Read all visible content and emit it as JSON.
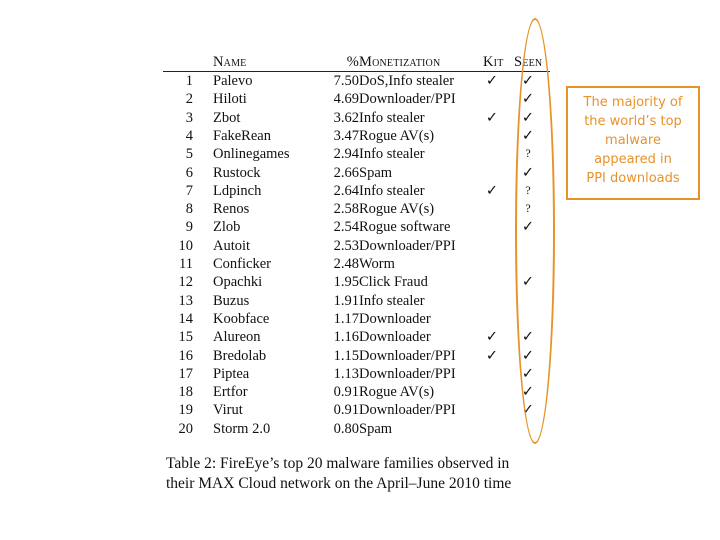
{
  "table": {
    "headers": {
      "rank": "",
      "name": "Name",
      "percent": "%",
      "monetization": "Monetization",
      "kit": "Kit",
      "seen": "Seen"
    },
    "rows": [
      {
        "rank": "1",
        "name": "Palevo",
        "percent": "7.50",
        "monetization": "DoS,Info stealer",
        "kit": "✓",
        "seen": "✓"
      },
      {
        "rank": "2",
        "name": "Hiloti",
        "percent": "4.69",
        "monetization": "Downloader/PPI",
        "kit": "",
        "seen": "✓"
      },
      {
        "rank": "3",
        "name": "Zbot",
        "percent": "3.62",
        "monetization": "Info stealer",
        "kit": "✓",
        "seen": "✓"
      },
      {
        "rank": "4",
        "name": "FakeRean",
        "percent": "3.47",
        "monetization": "Rogue AV(s)",
        "kit": "",
        "seen": "✓"
      },
      {
        "rank": "5",
        "name": "Onlinegames",
        "percent": "2.94",
        "monetization": "Info stealer",
        "kit": "",
        "seen": "?"
      },
      {
        "rank": "6",
        "name": "Rustock",
        "percent": "2.66",
        "monetization": "Spam",
        "kit": "",
        "seen": "✓"
      },
      {
        "rank": "7",
        "name": "Ldpinch",
        "percent": "2.64",
        "monetization": "Info stealer",
        "kit": "✓",
        "seen": "?"
      },
      {
        "rank": "8",
        "name": "Renos",
        "percent": "2.58",
        "monetization": "Rogue AV(s)",
        "kit": "",
        "seen": "?"
      },
      {
        "rank": "9",
        "name": "Zlob",
        "percent": "2.54",
        "monetization": "Rogue software",
        "kit": "",
        "seen": "✓"
      },
      {
        "rank": "10",
        "name": "Autoit",
        "percent": "2.53",
        "monetization": "Downloader/PPI",
        "kit": "",
        "seen": ""
      },
      {
        "rank": "11",
        "name": "Conficker",
        "percent": "2.48",
        "monetization": "Worm",
        "kit": "",
        "seen": ""
      },
      {
        "rank": "12",
        "name": "Opachki",
        "percent": "1.95",
        "monetization": "Click Fraud",
        "kit": "",
        "seen": "✓"
      },
      {
        "rank": "13",
        "name": "Buzus",
        "percent": "1.91",
        "monetization": "Info stealer",
        "kit": "",
        "seen": ""
      },
      {
        "rank": "14",
        "name": "Koobface",
        "percent": "1.17",
        "monetization": "Downloader",
        "kit": "",
        "seen": ""
      },
      {
        "rank": "15",
        "name": "Alureon",
        "percent": "1.16",
        "monetization": "Downloader",
        "kit": "✓",
        "seen": "✓"
      },
      {
        "rank": "16",
        "name": "Bredolab",
        "percent": "1.15",
        "monetization": "Downloader/PPI",
        "kit": "✓",
        "seen": "✓"
      },
      {
        "rank": "17",
        "name": "Piptea",
        "percent": "1.13",
        "monetization": "Downloader/PPI",
        "kit": "",
        "seen": "✓"
      },
      {
        "rank": "18",
        "name": "Ertfor",
        "percent": "0.91",
        "monetization": "Rogue AV(s)",
        "kit": "",
        "seen": "✓"
      },
      {
        "rank": "19",
        "name": "Virut",
        "percent": "0.91",
        "monetization": "Downloader/PPI",
        "kit": "",
        "seen": "✓"
      },
      {
        "rank": "20",
        "name": "Storm 2.0",
        "percent": "0.80",
        "monetization": "Spam",
        "kit": "",
        "seen": ""
      }
    ]
  },
  "caption": {
    "line1": "Table 2: FireEye’s top 20 malware families observed in",
    "line2": "their MAX Cloud network on the April–June 2010 time"
  },
  "annotation": {
    "text_lines": [
      "The majority of",
      "the world’s top",
      "malware",
      "appeared in",
      "PPI downloads"
    ],
    "color": "#e8922a"
  }
}
